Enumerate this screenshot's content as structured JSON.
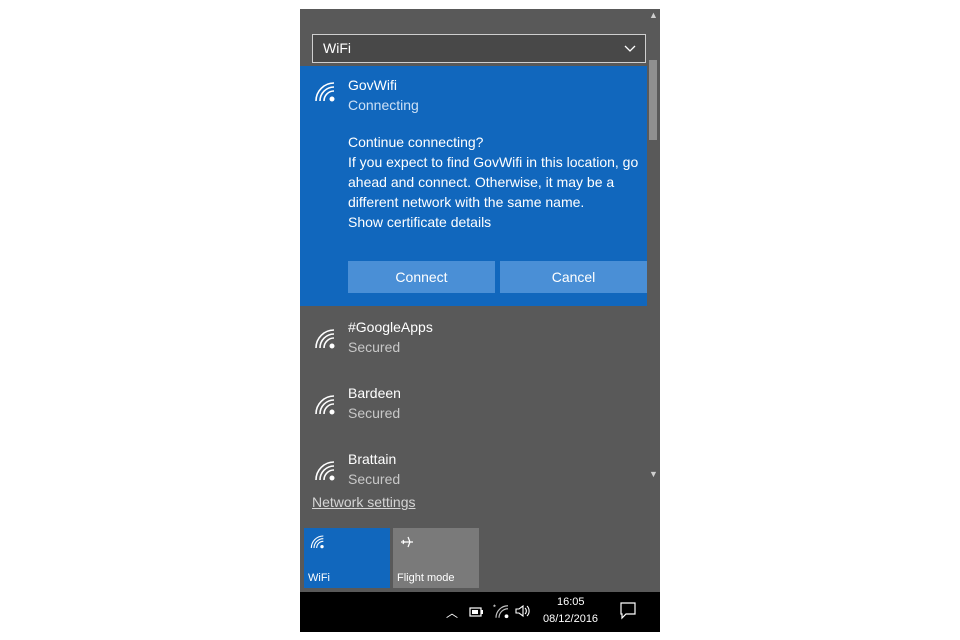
{
  "dropdown": {
    "value": "WiFi"
  },
  "active_network": {
    "ssid": "GovWifi",
    "status": "Connecting",
    "prompt_lines": [
      "Continue connecting?",
      "If you expect to find GovWifi in this location, go",
      "ahead and connect. Otherwise, it may be a",
      "different network with the same name.",
      "Show certificate details"
    ],
    "connect_label": "Connect",
    "cancel_label": "Cancel"
  },
  "networks": [
    {
      "ssid": "#GoogleApps",
      "status": "Secured"
    },
    {
      "ssid": "Bardeen",
      "status": "Secured"
    },
    {
      "ssid": "Brattain",
      "status": "Secured"
    }
  ],
  "network_settings_label": "Network settings",
  "quick_actions": [
    {
      "label": "WiFi",
      "icon": "wifi-icon",
      "active": true
    },
    {
      "label": "Flight mode",
      "icon": "airplane-icon",
      "active": false
    }
  ],
  "taskbar": {
    "time": "16:05",
    "date": "08/12/2016"
  },
  "colors": {
    "accent": "#1167bd",
    "panel_bg": "#595959",
    "tile_inactive": "#7a7a7a",
    "button_bg": "#4a8fd6",
    "taskbar_bg": "#000000"
  }
}
